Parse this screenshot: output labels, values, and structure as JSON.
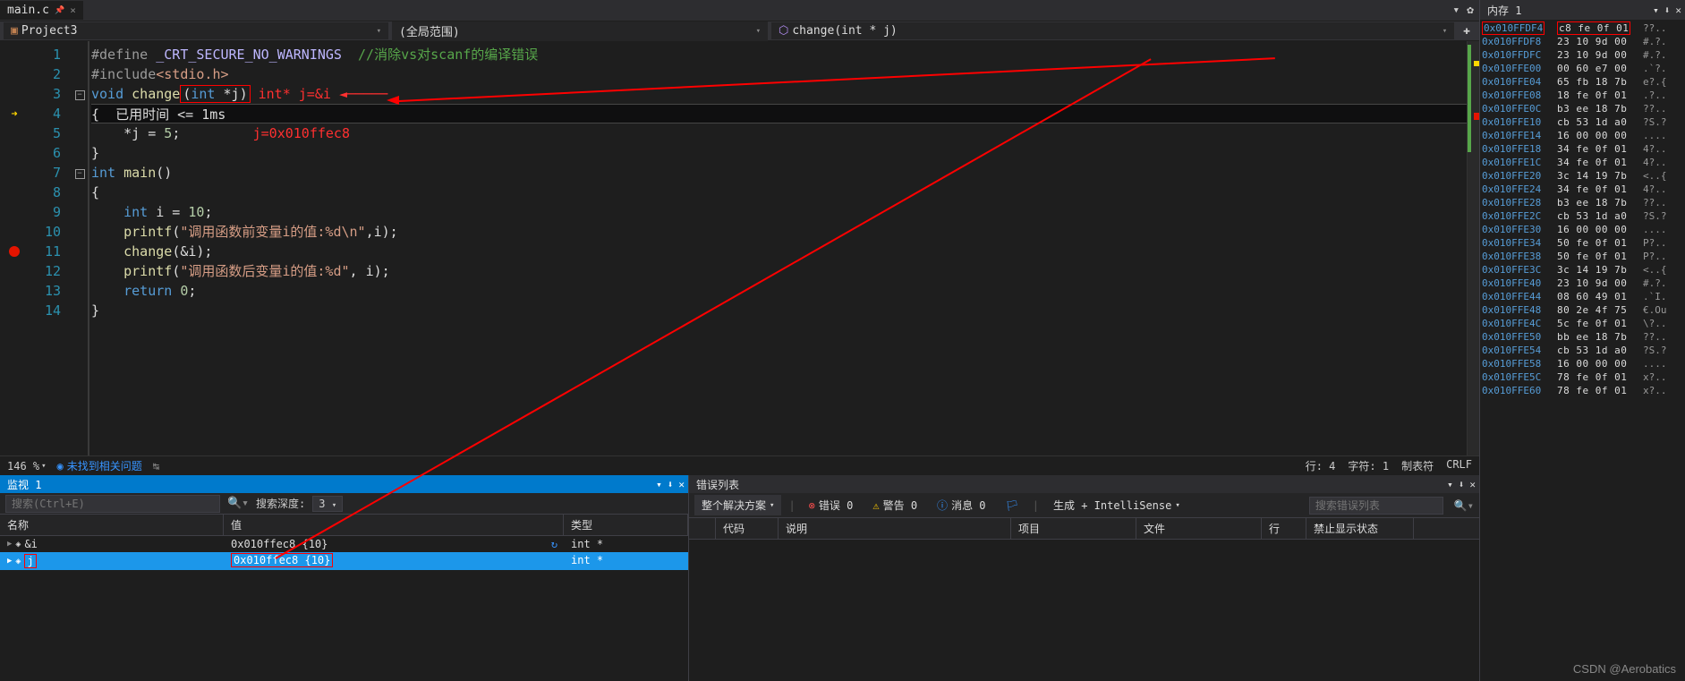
{
  "tab": {
    "name": "main.c",
    "close": "×",
    "pin": "📌"
  },
  "context": {
    "project": "Project3",
    "scope": "(全局范围)",
    "function": "change(int * j)"
  },
  "code": {
    "lines": [
      {
        "n": 1,
        "html": "<span class='tok-pp'>#define </span><span class='tok-mac'>_CRT_SECURE_NO_WARNINGS</span>  <span class='tok-cmt'>//消除vs对scanf的编译错误</span>"
      },
      {
        "n": 2,
        "html": "<span class='tok-pp'>#include</span><span class='tok-str'>&lt;stdio.h&gt;</span>"
      },
      {
        "n": 3,
        "html": "<span class='tok-kw'>void</span> <span class='tok-fn'>change</span><span class='red-box'>(<span class='tok-kw'>int</span> *<span class='tok-id'>j</span>)</span> <span class='annot-red'>int* j=&amp;i</span> <span class='annot-red'>◄─────</span>"
      },
      {
        "n": 4,
        "html": "{  <span class='tok-id'>已用时间 &lt;= 1ms</span>",
        "current": true
      },
      {
        "n": 5,
        "html": "    *<span class='tok-id'>j</span> = <span class='tok-num'>5</span>;         <span class='annot-red'>j=0x010ffec8</span>"
      },
      {
        "n": 6,
        "html": "}"
      },
      {
        "n": 7,
        "html": "<span class='tok-kw'>int</span> <span class='tok-fn'>main</span>()"
      },
      {
        "n": 8,
        "html": "{"
      },
      {
        "n": 9,
        "html": "    <span class='tok-kw'>int</span> <span class='tok-id'>i</span> = <span class='tok-num'>10</span>;"
      },
      {
        "n": 10,
        "html": "    <span class='tok-fn'>printf</span>(<span class='tok-str'>\"调用函数前变量i的值:%d\\n\"</span>,<span class='tok-id'>i</span>);"
      },
      {
        "n": 11,
        "html": "    <span class='tok-fn'>change</span>(&amp;<span class='tok-id'>i</span>);"
      },
      {
        "n": 12,
        "html": "    <span class='tok-fn'>printf</span>(<span class='tok-str'>\"调用函数后变量i的值:%d\"</span>, <span class='tok-id'>i</span>);"
      },
      {
        "n": 13,
        "html": "    <span class='tok-kw'>return</span> <span class='tok-num'>0</span>;"
      },
      {
        "n": 14,
        "html": "}"
      }
    ]
  },
  "status": {
    "zoom": "146 %",
    "issues": "未找到相关问题",
    "line": "行: 4",
    "col": "字符: 1",
    "tabs": "制表符",
    "eol": "CRLF"
  },
  "watch": {
    "title": "监视 1",
    "search_ph": "搜索(Ctrl+E)",
    "depth_lbl": "搜索深度:",
    "depth_val": "3",
    "cols": {
      "name": "名称",
      "value": "值",
      "type": "类型"
    },
    "rows": [
      {
        "name": "&i",
        "value": "0x010ffec8 {10}",
        "type": "int *",
        "sel": false,
        "refresh": true
      },
      {
        "name": "j",
        "value": "0x010ffec8 {10}",
        "type": "int *",
        "sel": true,
        "boxed": true
      }
    ]
  },
  "errors": {
    "title": "错误列表",
    "scope": "整个解决方案",
    "err_lbl": "错误 0",
    "warn_lbl": "警告 0",
    "info_lbl": "消息 0",
    "build": "生成 + IntelliSense",
    "search_ph": "搜索错误列表",
    "cols": [
      "",
      "代码",
      "说明",
      "项目",
      "文件",
      "行",
      "禁止显示状态"
    ]
  },
  "memory": {
    "title": "内存 1",
    "rows": [
      {
        "addr": "0x010FFDF4",
        "hex": "c8 fe 0f 01",
        "ascii": "??..",
        "hl": true,
        "addr_hl": true
      },
      {
        "addr": "0x010FFDF8",
        "hex": "23 10 9d 00",
        "ascii": "#.?."
      },
      {
        "addr": "0x010FFDFC",
        "hex": "23 10 9d 00",
        "ascii": "#.?."
      },
      {
        "addr": "0x010FFE00",
        "hex": "00 60 e7 00",
        "ascii": ".`?."
      },
      {
        "addr": "0x010FFE04",
        "hex": "65 fb 18 7b",
        "ascii": "e?.{"
      },
      {
        "addr": "0x010FFE08",
        "hex": "18 fe 0f 01",
        "ascii": ".?.."
      },
      {
        "addr": "0x010FFE0C",
        "hex": "b3 ee 18 7b",
        "ascii": "??.."
      },
      {
        "addr": "0x010FFE10",
        "hex": "cb 53 1d a0",
        "ascii": "?S.?"
      },
      {
        "addr": "0x010FFE14",
        "hex": "16 00 00 00",
        "ascii": "...."
      },
      {
        "addr": "0x010FFE18",
        "hex": "34 fe 0f 01",
        "ascii": "4?.."
      },
      {
        "addr": "0x010FFE1C",
        "hex": "34 fe 0f 01",
        "ascii": "4?.."
      },
      {
        "addr": "0x010FFE20",
        "hex": "3c 14 19 7b",
        "ascii": "<..{"
      },
      {
        "addr": "0x010FFE24",
        "hex": "34 fe 0f 01",
        "ascii": "4?.."
      },
      {
        "addr": "0x010FFE28",
        "hex": "b3 ee 18 7b",
        "ascii": "??.."
      },
      {
        "addr": "0x010FFE2C",
        "hex": "cb 53 1d a0",
        "ascii": "?S.?"
      },
      {
        "addr": "0x010FFE30",
        "hex": "16 00 00 00",
        "ascii": "...."
      },
      {
        "addr": "0x010FFE34",
        "hex": "50 fe 0f 01",
        "ascii": "P?.."
      },
      {
        "addr": "0x010FFE38",
        "hex": "50 fe 0f 01",
        "ascii": "P?.."
      },
      {
        "addr": "0x010FFE3C",
        "hex": "3c 14 19 7b",
        "ascii": "<..{"
      },
      {
        "addr": "0x010FFE40",
        "hex": "23 10 9d 00",
        "ascii": "#.?."
      },
      {
        "addr": "0x010FFE44",
        "hex": "08 60 49 01",
        "ascii": ".`I."
      },
      {
        "addr": "0x010FFE48",
        "hex": "80 2e 4f 75",
        "ascii": "€.Ou"
      },
      {
        "addr": "0x010FFE4C",
        "hex": "5c fe 0f 01",
        "ascii": "\\?.."
      },
      {
        "addr": "0x010FFE50",
        "hex": "bb ee 18 7b",
        "ascii": "??.."
      },
      {
        "addr": "0x010FFE54",
        "hex": "cb 53 1d a0",
        "ascii": "?S.?"
      },
      {
        "addr": "0x010FFE58",
        "hex": "16 00 00 00",
        "ascii": "...."
      },
      {
        "addr": "0x010FFE5C",
        "hex": "78 fe 0f 01",
        "ascii": "x?.."
      },
      {
        "addr": "0x010FFE60",
        "hex": "78 fe 0f 01",
        "ascii": "x?.."
      }
    ]
  },
  "watermark": "CSDN @Aerobatics"
}
